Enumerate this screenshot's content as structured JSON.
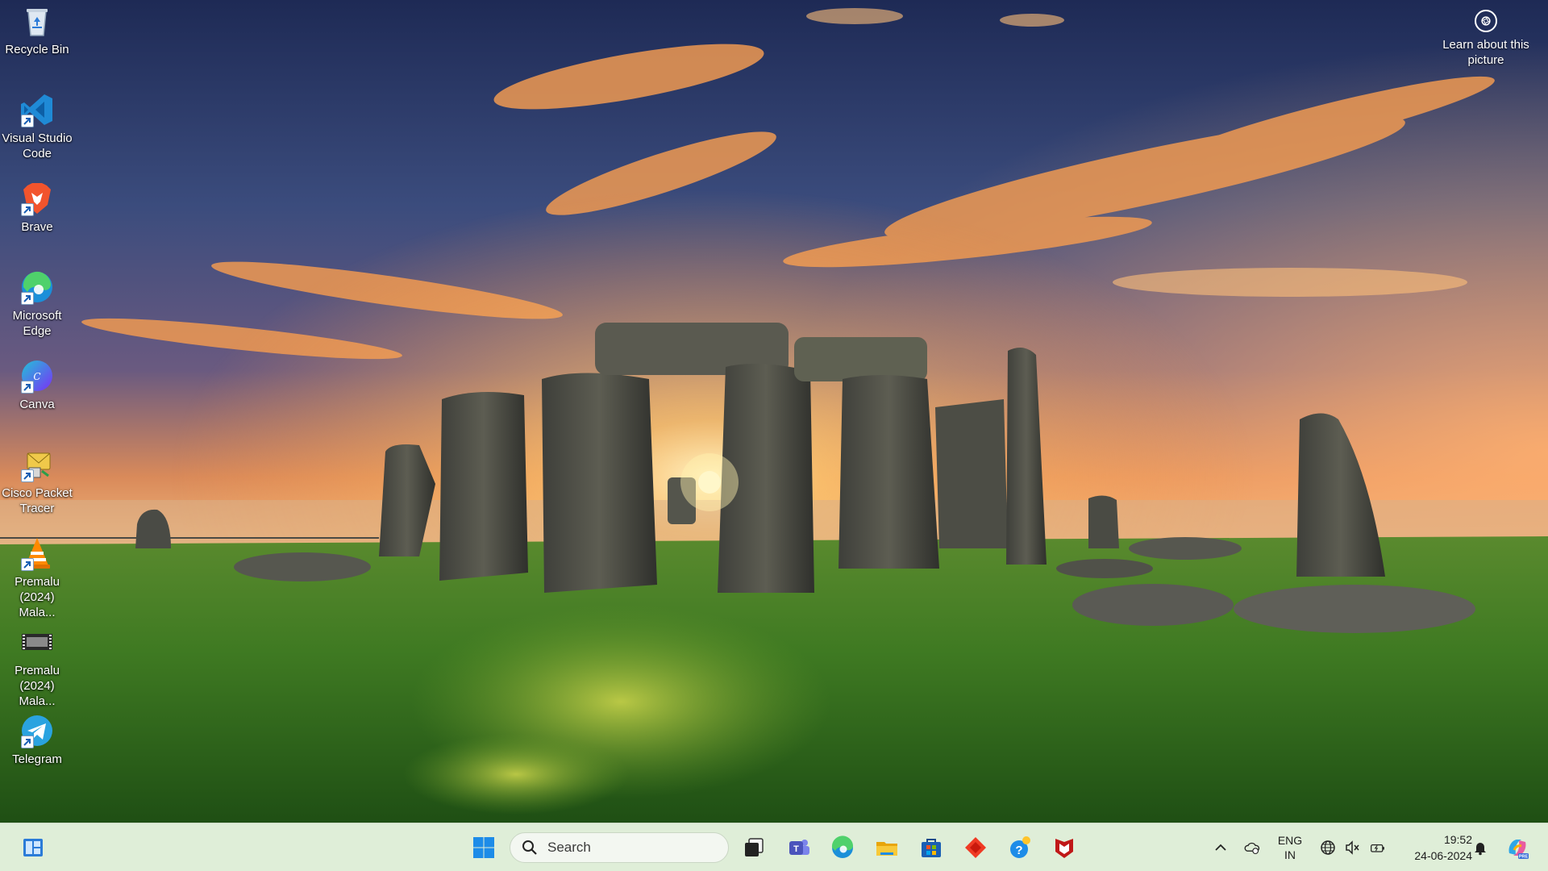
{
  "desktop": {
    "icons": [
      {
        "label": "Recycle Bin",
        "icon": "recycle-bin-icon"
      },
      {
        "label": "Visual Studio Code",
        "icon": "vscode-icon"
      },
      {
        "label": "Brave",
        "icon": "brave-icon"
      },
      {
        "label": "Microsoft Edge",
        "icon": "edge-icon"
      },
      {
        "label": "Canva",
        "icon": "canva-icon"
      },
      {
        "label": "Cisco Packet Tracer",
        "icon": "packet-tracer-icon"
      },
      {
        "label": "Premalu (2024) Mala...",
        "icon": "vlc-icon"
      },
      {
        "label": "Premalu (2024) Mala...",
        "icon": "video-file-icon"
      },
      {
        "label": "Telegram",
        "icon": "telegram-icon"
      }
    ],
    "learn_picture": "Learn about this picture"
  },
  "taskbar": {
    "search_label": "Search",
    "apps": [
      "start-icon",
      "task-view-icon",
      "teams-icon",
      "edge-icon",
      "file-explorer-icon",
      "microsoft-store-icon",
      "anydesk-icon",
      "get-help-icon",
      "mcafee-icon"
    ],
    "tray": {
      "language_line1": "ENG",
      "language_line2": "IN",
      "time": "19:52",
      "date": "24-06-2024"
    }
  },
  "colors": {
    "taskbar_bg": "#dfeed8",
    "accent": "#0078d4"
  }
}
